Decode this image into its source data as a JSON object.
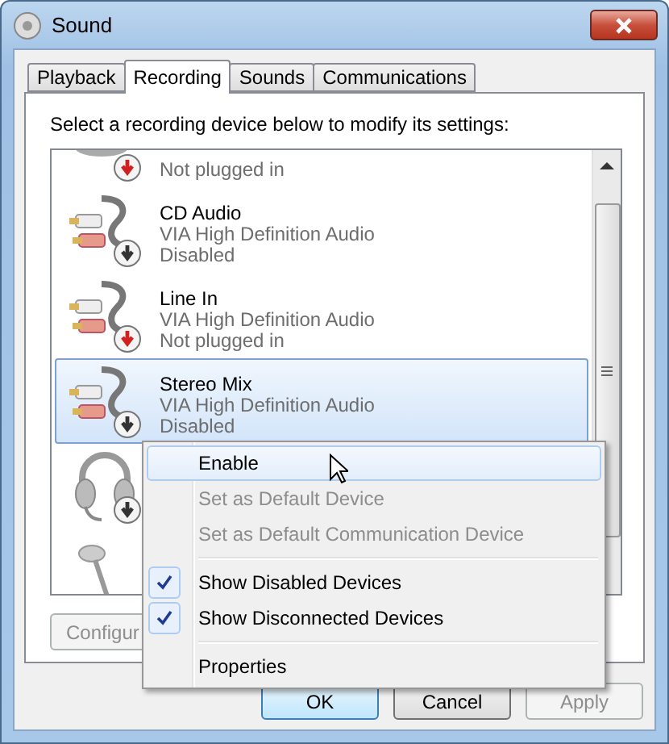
{
  "window": {
    "title": "Sound"
  },
  "tabs": [
    {
      "label": "Playback",
      "selected": false
    },
    {
      "label": "Recording",
      "selected": true
    },
    {
      "label": "Sounds",
      "selected": false
    },
    {
      "label": "Communications",
      "selected": false
    }
  ],
  "instruction": "Select a recording device below to modify its settings:",
  "devices": [
    {
      "kind": "microphone",
      "status": "Not plugged in",
      "unplugged": true,
      "selected": false
    },
    {
      "kind": "cable",
      "name": "CD Audio",
      "driver": "VIA High Definition Audio",
      "status": "Disabled",
      "unplugged": false,
      "disabled": true,
      "selected": false
    },
    {
      "kind": "cable",
      "name": "Line In",
      "driver": "VIA High Definition Audio",
      "status": "Not plugged in",
      "unplugged": true,
      "selected": false
    },
    {
      "kind": "cable",
      "name": "Stereo Mix",
      "driver": "VIA High Definition Audio",
      "status": "Disabled",
      "unplugged": false,
      "disabled": true,
      "selected": true
    },
    {
      "kind": "headset",
      "unplugged": false,
      "disabled": true,
      "selected": false
    },
    {
      "kind": "stand",
      "selected": false
    }
  ],
  "configure_button": {
    "label": "Configur",
    "disabled": true
  },
  "context_menu": [
    {
      "kind": "item",
      "label": "Enable",
      "selected": true,
      "disabled": false,
      "checked": false
    },
    {
      "kind": "item",
      "label": "Set as Default Device",
      "selected": false,
      "disabled": true,
      "checked": false
    },
    {
      "kind": "item",
      "label": "Set as Default Communication Device",
      "selected": false,
      "disabled": true,
      "checked": false
    },
    {
      "kind": "separator"
    },
    {
      "kind": "item",
      "label": "Show Disabled Devices",
      "selected": false,
      "disabled": false,
      "checked": true
    },
    {
      "kind": "item",
      "label": "Show Disconnected Devices",
      "selected": false,
      "disabled": false,
      "checked": true
    },
    {
      "kind": "separator"
    },
    {
      "kind": "item",
      "label": "Properties",
      "selected": false,
      "disabled": false,
      "checked": false
    }
  ],
  "buttons": [
    {
      "label": "OK",
      "default": true,
      "disabled": false
    },
    {
      "label": "Cancel",
      "default": false,
      "disabled": false
    },
    {
      "label": "Apply",
      "default": false,
      "disabled": true
    }
  ]
}
